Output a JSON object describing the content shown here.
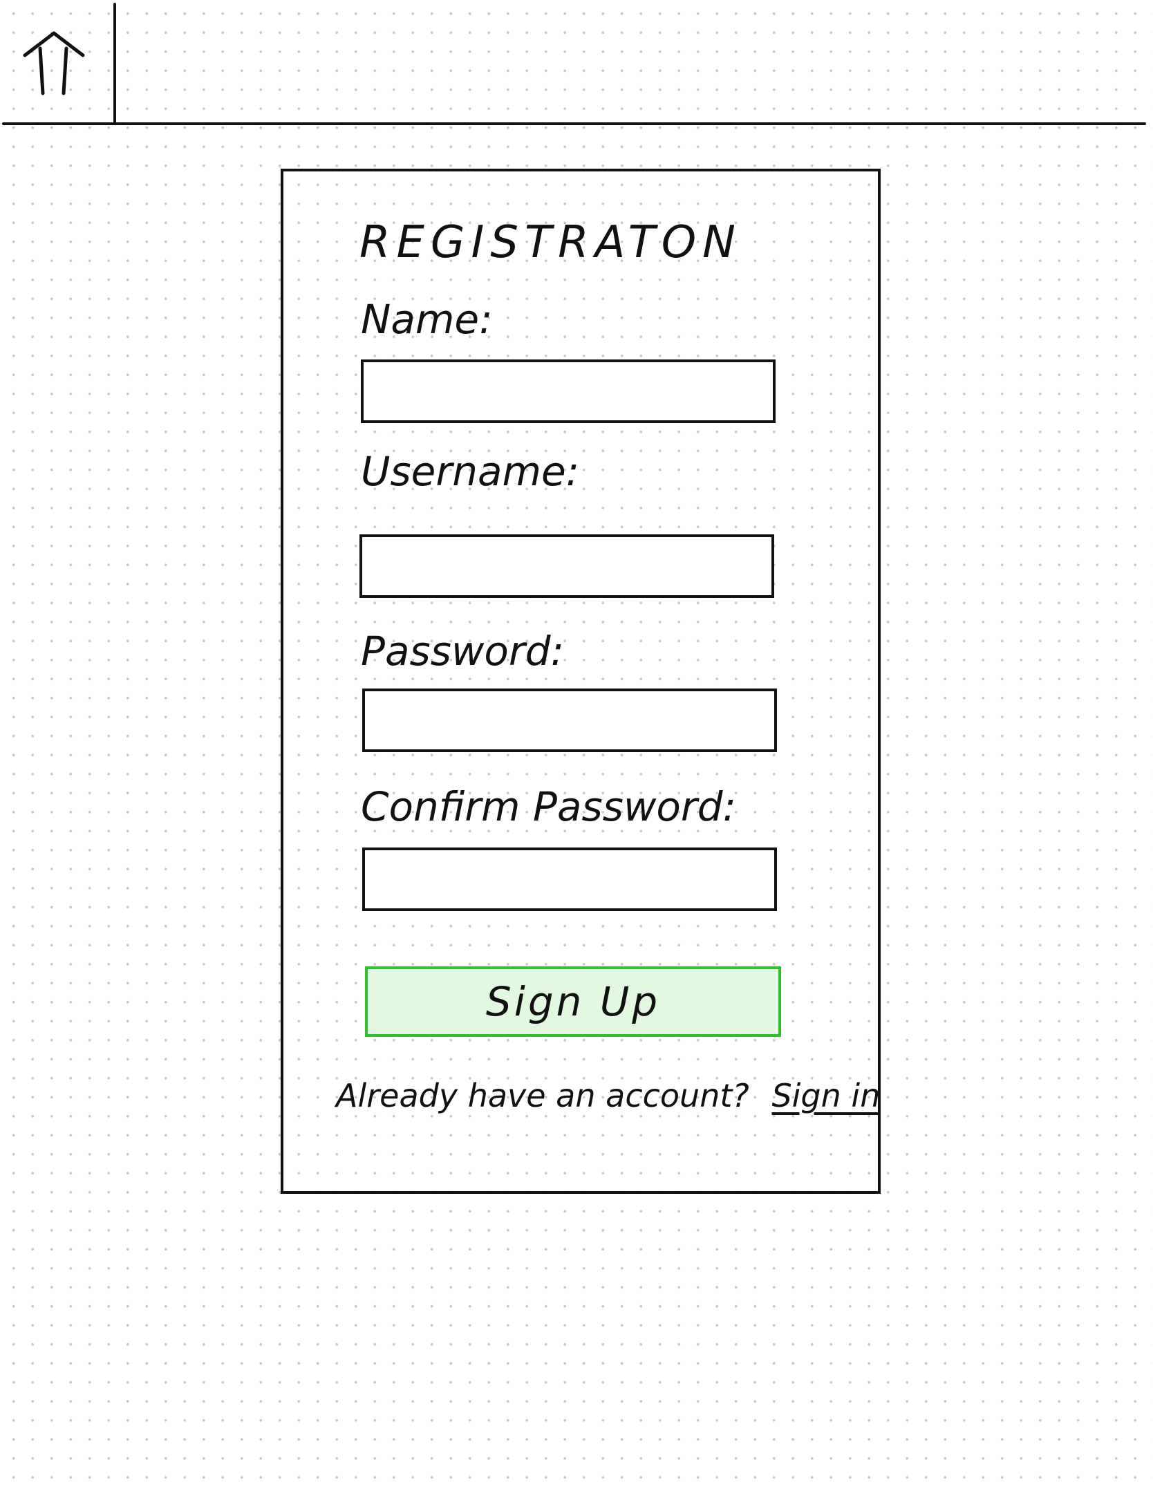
{
  "header": {
    "home_icon": "home-icon"
  },
  "form": {
    "title": "REGISTRATON",
    "fields": [
      {
        "label": "Name:",
        "value": ""
      },
      {
        "label": "Username:",
        "value": ""
      },
      {
        "label": "Password:",
        "value": ""
      },
      {
        "label": "Confirm Password:",
        "value": ""
      }
    ],
    "submit_label": "Sign Up",
    "submit_colors": {
      "fill": "#e2f8e1",
      "border": "#2fbf2f"
    },
    "signin_prompt": "Already have an account?",
    "signin_link": "Sign in"
  }
}
